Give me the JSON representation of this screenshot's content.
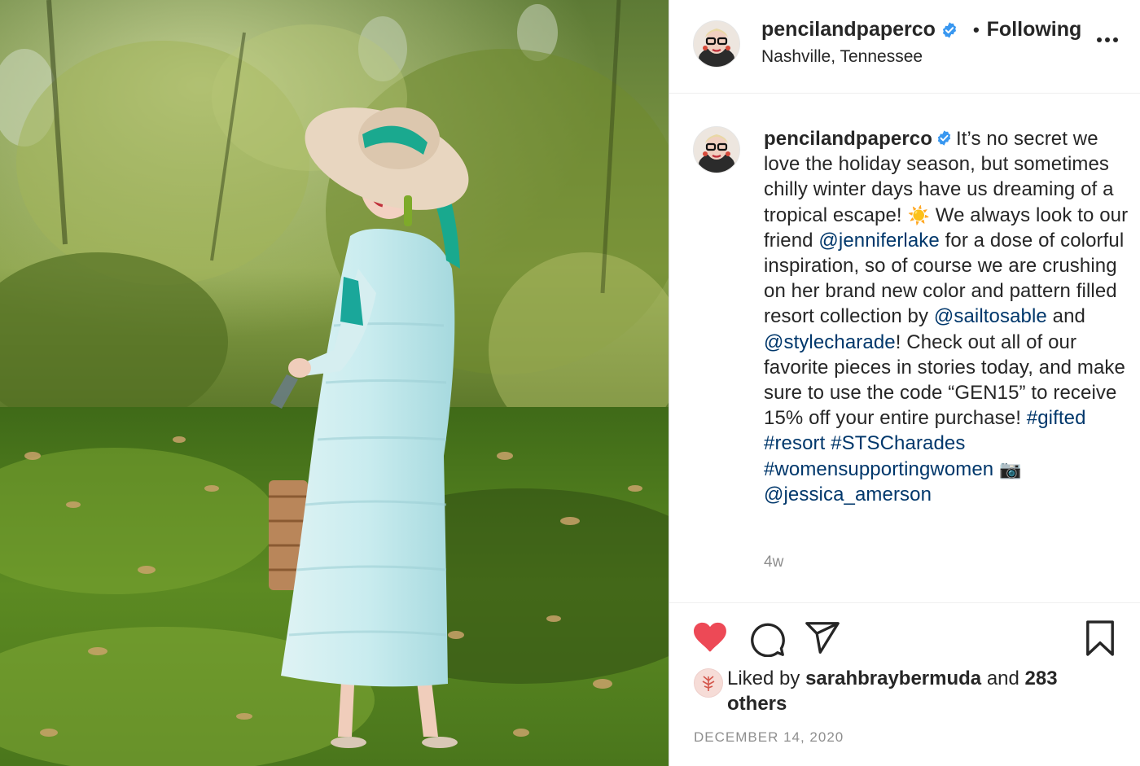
{
  "header": {
    "username": "pencilandpaperco",
    "separator": "•",
    "follow_label": "Following",
    "location": "Nashville, Tennessee"
  },
  "caption": {
    "username": "pencilandpaperco",
    "part1": "It’s no secret we love the holiday season, but sometimes chilly winter days have us dreaming of a tropical escape!",
    "emoji_sun": "☀️",
    "part2": "We always look to our friend",
    "mention1": "@jenniferlake",
    "part3": "for a dose of colorful inspiration, so of course we are crushing on her brand new color and pattern filled resort collection by",
    "mention2": "@sailtosable",
    "part4": "and",
    "mention3": "@stylecharade",
    "part5": "! Check out all of our favorite pieces in stories today, and make sure to use the code “GEN15” to receive 15% off your entire purchase!",
    "hashtag1": "#gifted",
    "hashtag2": "#resort",
    "hashtag3": "#STSCharades",
    "hashtag4": "#womensupportingwomen",
    "emoji_camera": "📷",
    "mention4": "@jessica_amerson",
    "time_ago": "4w"
  },
  "likes": {
    "prefix": "Liked by",
    "liked_user": "sarahbraybermuda",
    "conjunction": "and",
    "others": "283 others"
  },
  "post_date": "DECEMBER 14, 2020",
  "icons": {
    "like": "heart-filled-icon",
    "comment": "comment-bubble-icon",
    "share": "paper-plane-icon",
    "save": "bookmark-icon",
    "more": "more-options-icon",
    "verified": "verified-badge-icon"
  },
  "colors": {
    "like_red": "#ed4956",
    "verified_blue": "#3897f0",
    "link_blue": "#00376b",
    "muted_gray": "#8e8e8e"
  }
}
